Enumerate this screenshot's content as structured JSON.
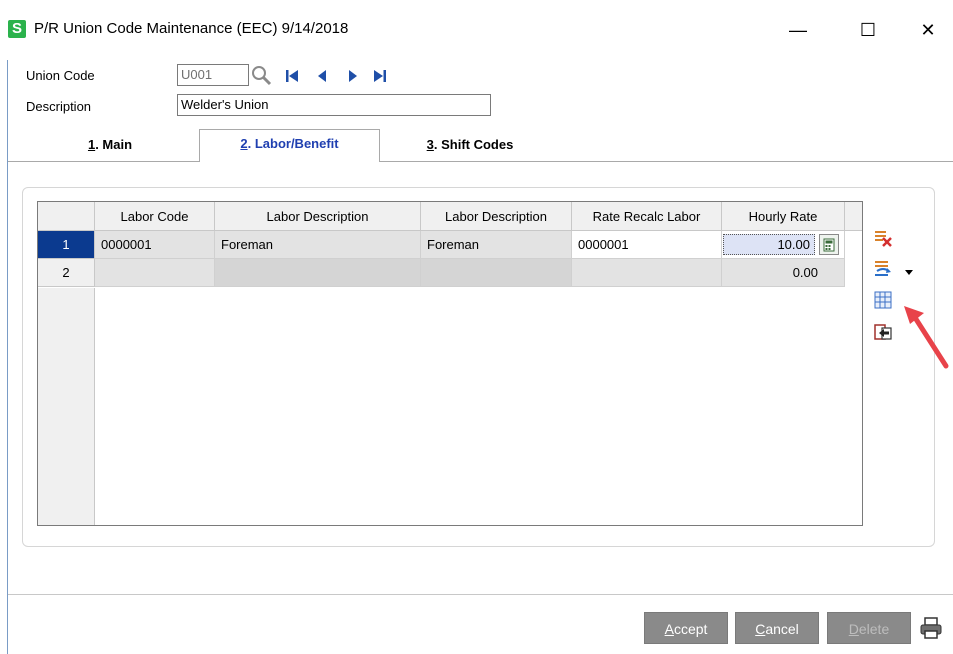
{
  "window": {
    "app_icon_letter": "S",
    "title": "P/R Union Code Maintenance (EEC) 9/14/2018",
    "minimize": "—",
    "maximize": "☐",
    "close": "✕"
  },
  "form": {
    "union_code_label": "Union Code",
    "union_code_value": "U001",
    "description_label": "Description",
    "description_value": "Welder's Union"
  },
  "tabs": [
    {
      "num": "1",
      "label": ". Main"
    },
    {
      "num": "2",
      "label": ". Labor/Benefit"
    },
    {
      "num": "3",
      "label": ". Shift Codes"
    }
  ],
  "grid": {
    "columns": [
      "Labor Code",
      "Labor Description",
      "Labor Description",
      "Rate Recalc Labor",
      "Hourly Rate"
    ],
    "rows": [
      {
        "num": "1",
        "labor_code": "0000001",
        "labor_desc": "Foreman",
        "labor_desc2": "Foreman",
        "rate_recalc": "0000001",
        "hourly_rate": "10.00"
      },
      {
        "num": "2",
        "labor_code": "",
        "labor_desc": "",
        "labor_desc2": "",
        "rate_recalc": "",
        "hourly_rate": "0.00"
      }
    ]
  },
  "buttons": {
    "accept_u": "A",
    "accept_rest": "ccept",
    "cancel_u": "C",
    "cancel_rest": "ancel",
    "delete_u": "D",
    "delete_rest": "elete"
  },
  "colors": {
    "selected_row": "#0b3a8f",
    "active_tab_text": "#1f3fb0",
    "annotation_arrow": "#e8434a"
  }
}
